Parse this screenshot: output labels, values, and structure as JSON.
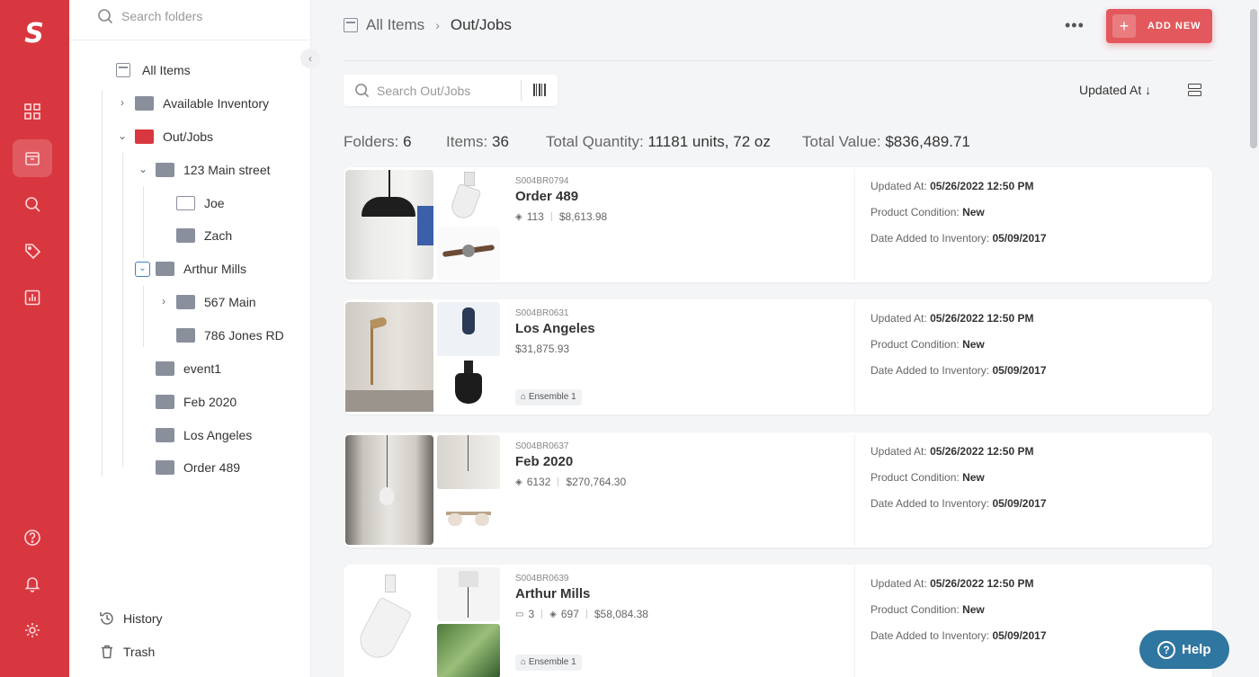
{
  "brand": {
    "logo": "S",
    "color": "#d9373f"
  },
  "sidebar_icons": [
    "dashboard-icon",
    "items-icon",
    "search-icon",
    "tags-icon",
    "reports-icon",
    "help-icon",
    "bell-icon",
    "gear-icon"
  ],
  "folder_panel": {
    "search_placeholder": "Search folders",
    "tree": {
      "all_items": "All Items",
      "available_inventory": "Available Inventory",
      "out_jobs": "Out/Jobs",
      "main_street": "123 Main street",
      "joe": "Joe",
      "zach": "Zach",
      "arthur_mills": "Arthur Mills",
      "main_567": "567 Main",
      "jones_rd": "786 Jones RD",
      "event1": "event1",
      "feb2020": "Feb 2020",
      "los_angeles": "Los Angeles",
      "order489": "Order 489"
    },
    "history": "History",
    "trash": "Trash"
  },
  "header": {
    "breadcrumb_root": "All Items",
    "breadcrumb_current": "Out/Jobs",
    "more": "•••",
    "add_new": "ADD NEW"
  },
  "toolbar": {
    "search_placeholder": "Search Out/Jobs",
    "sort_label": "Updated At ↓"
  },
  "summary": {
    "folders_label": "Folders:",
    "folders_value": "6",
    "items_label": "Items:",
    "items_value": "36",
    "qty_label": "Total Quantity:",
    "qty_value": "11181 units, 72 oz",
    "value_label": "Total Value:",
    "value_value": "$836,489.71"
  },
  "items": [
    {
      "sku": "S004BR0794",
      "name": "Order 489",
      "qty": "113",
      "value": "$8,613.98",
      "updated_label": "Updated At:",
      "updated": "05/26/2022 12:50 PM",
      "condition_label": "Product Condition:",
      "condition": "New",
      "added_label": "Date Added to Inventory:",
      "added": "05/09/2017"
    },
    {
      "sku": "S004BR0631",
      "name": "Los Angeles",
      "value": "$31,875.93",
      "tag": "Ensemble 1",
      "updated_label": "Updated At:",
      "updated": "05/26/2022 12:50 PM",
      "condition_label": "Product Condition:",
      "condition": "New",
      "added_label": "Date Added to Inventory:",
      "added": "05/09/2017"
    },
    {
      "sku": "S004BR0637",
      "name": "Feb 2020",
      "qty": "6132",
      "value": "$270,764.30",
      "updated_label": "Updated At:",
      "updated": "05/26/2022 12:50 PM",
      "condition_label": "Product Condition:",
      "condition": "New",
      "added_label": "Date Added to Inventory:",
      "added": "05/09/2017"
    },
    {
      "sku": "S004BR0639",
      "name": "Arthur Mills",
      "folders": "3",
      "qty": "697",
      "value": "$58,084.38",
      "tag": "Ensemble 1",
      "updated_label": "Updated At:",
      "updated": "05/26/2022 12:50 PM",
      "condition_label": "Product Condition:",
      "condition": "New",
      "added_label": "Date Added to Inventory:",
      "added": "05/09/2017"
    }
  ],
  "help_button": "Help"
}
